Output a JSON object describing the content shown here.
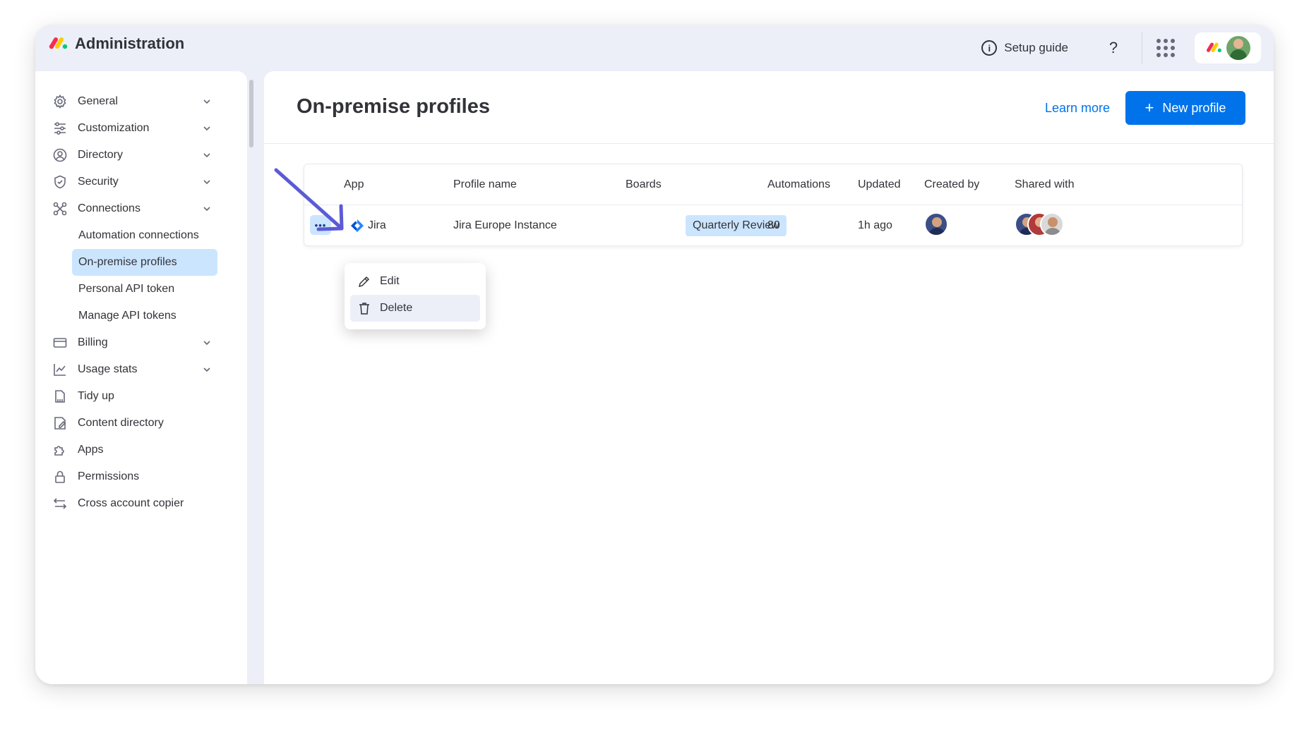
{
  "app": {
    "title": "Administration"
  },
  "topbar": {
    "setup_guide": "Setup guide",
    "help": "?"
  },
  "sidebar": {
    "items": [
      {
        "label": "General",
        "icon": "gear-icon",
        "expandable": true
      },
      {
        "label": "Customization",
        "icon": "sliders-icon",
        "expandable": true
      },
      {
        "label": "Directory",
        "icon": "user-circle-icon",
        "expandable": true
      },
      {
        "label": "Security",
        "icon": "shield-icon",
        "expandable": true
      },
      {
        "label": "Connections",
        "icon": "connections-icon",
        "expandable": true
      }
    ],
    "sub_items": [
      {
        "label": "Automation connections"
      },
      {
        "label": "On-premise profiles",
        "active": true
      },
      {
        "label": "Personal API token"
      },
      {
        "label": "Manage API tokens"
      }
    ],
    "items_after": [
      {
        "label": "Billing",
        "icon": "credit-card-icon",
        "expandable": true
      },
      {
        "label": "Usage stats",
        "icon": "chart-icon",
        "expandable": true
      },
      {
        "label": "Tidy up",
        "icon": "broom-icon"
      },
      {
        "label": "Content directory",
        "icon": "content-icon"
      },
      {
        "label": "Apps",
        "icon": "puzzle-icon"
      },
      {
        "label": "Permissions",
        "icon": "lock-icon"
      },
      {
        "label": "Cross account copier",
        "icon": "transfer-icon"
      }
    ]
  },
  "main": {
    "title": "On-premise profiles",
    "learn_more": "Learn more",
    "new_profile": "New profile",
    "new_profile_icon": "+"
  },
  "table": {
    "columns": [
      "App",
      "Profile name",
      "Boards",
      "Automations",
      "Updated",
      "Created by",
      "Shared with"
    ],
    "rows": [
      {
        "more": "•••",
        "app": "Jira",
        "profile_name": "Jira Europe Instance",
        "board": "Quarterly Review",
        "automations": "80",
        "updated": "1h ago"
      }
    ]
  },
  "row_menu": {
    "items": [
      {
        "label": "Edit",
        "icon": "pencil-icon"
      },
      {
        "label": "Delete",
        "icon": "trash-icon"
      }
    ]
  },
  "colors": {
    "primary": "#0073ea",
    "selected_bg": "#cce5ff",
    "surface": "#eceff8",
    "text": "#323338",
    "arrow": "#5b5bd6"
  }
}
